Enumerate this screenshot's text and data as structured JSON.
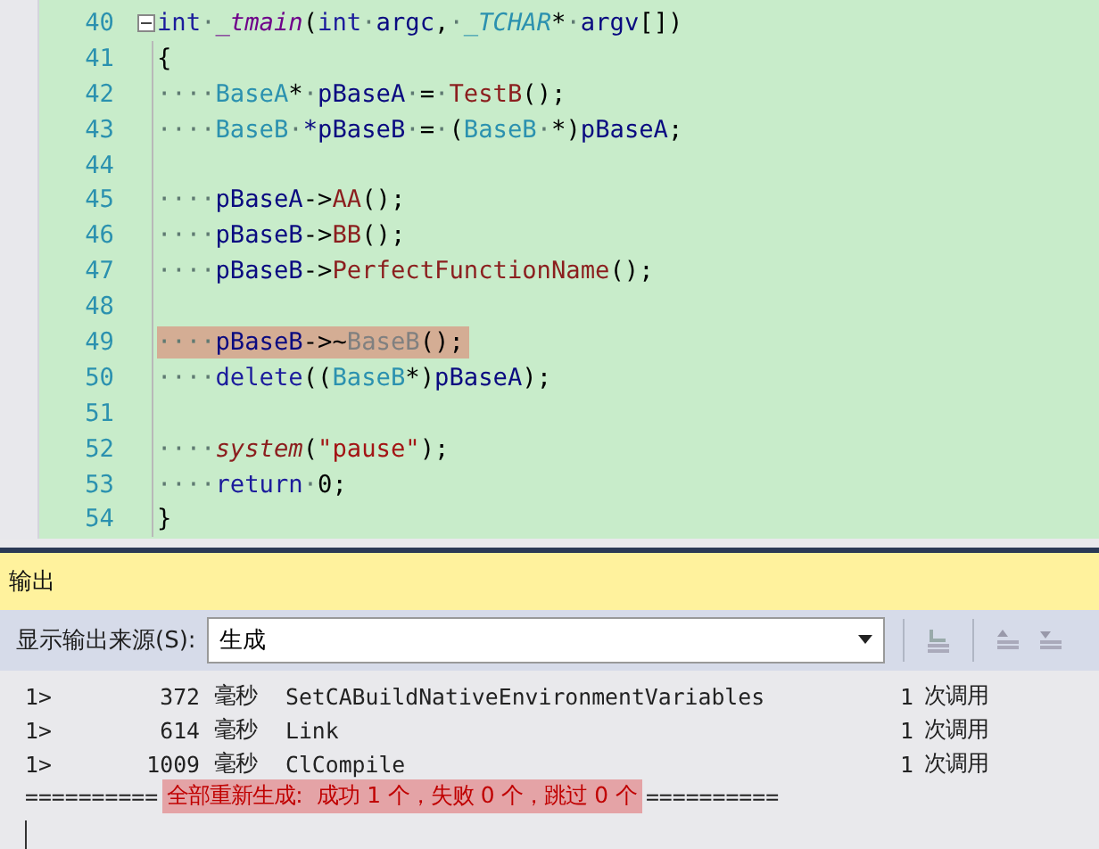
{
  "editor": {
    "lines": [
      {
        "number": "40",
        "highlighted": false,
        "tokens": [
          {
            "kind": "kw",
            "text": "int"
          },
          {
            "kind": "ws",
            "text": "·"
          },
          {
            "kind": "macro",
            "text": "_tmain"
          },
          {
            "kind": "punct",
            "text": "("
          },
          {
            "kind": "kw",
            "text": "int"
          },
          {
            "kind": "ws",
            "text": "·"
          },
          {
            "kind": "ident",
            "text": "argc"
          },
          {
            "kind": "punct",
            "text": ","
          },
          {
            "kind": "ws",
            "text": "·"
          },
          {
            "kind": "typeitalic",
            "text": "_TCHAR"
          },
          {
            "kind": "punct",
            "text": "*"
          },
          {
            "kind": "ws",
            "text": "·"
          },
          {
            "kind": "ident",
            "text": "argv"
          },
          {
            "kind": "punct",
            "text": "[])"
          }
        ]
      },
      {
        "number": "41",
        "highlighted": false,
        "tokens": [
          {
            "kind": "punct",
            "text": "{"
          }
        ]
      },
      {
        "number": "42",
        "highlighted": false,
        "tokens": [
          {
            "kind": "ws",
            "text": "····"
          },
          {
            "kind": "type",
            "text": "BaseA"
          },
          {
            "kind": "punct",
            "text": "*"
          },
          {
            "kind": "ws",
            "text": "·"
          },
          {
            "kind": "ident",
            "text": "pBaseA"
          },
          {
            "kind": "ws",
            "text": "·"
          },
          {
            "kind": "punct",
            "text": "="
          },
          {
            "kind": "ws",
            "text": "·"
          },
          {
            "kind": "func",
            "text": "TestB"
          },
          {
            "kind": "punct",
            "text": "();"
          }
        ]
      },
      {
        "number": "43",
        "highlighted": false,
        "tokens": [
          {
            "kind": "ws",
            "text": "····"
          },
          {
            "kind": "type",
            "text": "BaseB"
          },
          {
            "kind": "ws",
            "text": "·"
          },
          {
            "kind": "ident",
            "text": "*pBaseB"
          },
          {
            "kind": "ws",
            "text": "·"
          },
          {
            "kind": "punct",
            "text": "="
          },
          {
            "kind": "ws",
            "text": "·"
          },
          {
            "kind": "punct",
            "text": "("
          },
          {
            "kind": "type",
            "text": "BaseB"
          },
          {
            "kind": "ws",
            "text": "·"
          },
          {
            "kind": "punct",
            "text": "*)"
          },
          {
            "kind": "ident",
            "text": "pBaseA"
          },
          {
            "kind": "punct",
            "text": ";"
          }
        ]
      },
      {
        "number": "44",
        "highlighted": false
      },
      {
        "number": "45",
        "highlighted": false,
        "tokens": [
          {
            "kind": "ws",
            "text": "····"
          },
          {
            "kind": "ident",
            "text": "pBaseA"
          },
          {
            "kind": "punct",
            "text": "->"
          },
          {
            "kind": "func",
            "text": "AA"
          },
          {
            "kind": "punct",
            "text": "();"
          }
        ]
      },
      {
        "number": "46",
        "highlighted": false,
        "tokens": [
          {
            "kind": "ws",
            "text": "····"
          },
          {
            "kind": "ident",
            "text": "pBaseB"
          },
          {
            "kind": "punct",
            "text": "->"
          },
          {
            "kind": "func",
            "text": "BB"
          },
          {
            "kind": "punct",
            "text": "();"
          }
        ]
      },
      {
        "number": "47",
        "highlighted": false,
        "tokens": [
          {
            "kind": "ws",
            "text": "····"
          },
          {
            "kind": "ident",
            "text": "pBaseB"
          },
          {
            "kind": "punct",
            "text": "->"
          },
          {
            "kind": "func",
            "text": "PerfectFunctionName"
          },
          {
            "kind": "punct",
            "text": "();"
          }
        ]
      },
      {
        "number": "48",
        "highlighted": false
      },
      {
        "number": "49",
        "highlighted": true,
        "tokens": [
          {
            "kind": "ws",
            "text": "····"
          },
          {
            "kind": "ident",
            "text": "pBaseB"
          },
          {
            "kind": "punct",
            "text": "->~"
          },
          {
            "kind": "dim",
            "text": "BaseB"
          },
          {
            "kind": "punct",
            "text": "();"
          }
        ]
      },
      {
        "number": "50",
        "highlighted": false,
        "tokens": [
          {
            "kind": "ws",
            "text": "····"
          },
          {
            "kind": "kw",
            "text": "delete"
          },
          {
            "kind": "punct",
            "text": "(("
          },
          {
            "kind": "type",
            "text": "BaseB"
          },
          {
            "kind": "punct",
            "text": "*)"
          },
          {
            "kind": "ident",
            "text": "pBaseA"
          },
          {
            "kind": "punct",
            "text": ");"
          }
        ]
      },
      {
        "number": "51",
        "highlighted": false
      },
      {
        "number": "52",
        "highlighted": false,
        "tokens": [
          {
            "kind": "ws",
            "text": "····"
          },
          {
            "kind": "funcitalic",
            "text": "system"
          },
          {
            "kind": "punct",
            "text": "("
          },
          {
            "kind": "string",
            "text": "\"pause\""
          },
          {
            "kind": "punct",
            "text": ");"
          }
        ]
      },
      {
        "number": "53",
        "highlighted": false,
        "tokens": [
          {
            "kind": "ws",
            "text": "····"
          },
          {
            "kind": "kw",
            "text": "return"
          },
          {
            "kind": "ws",
            "text": "·"
          },
          {
            "kind": "punct",
            "text": "0;"
          }
        ]
      },
      {
        "number": "54",
        "highlighted": false,
        "tokens": [
          {
            "kind": "punct",
            "text": "}"
          }
        ]
      }
    ]
  },
  "output": {
    "title": "输出",
    "source_label": "显示输出来源(S):",
    "source_value": "生成",
    "rows": [
      {
        "prefix": "1>",
        "time": "372",
        "unit": "毫秒",
        "target": "SetCABuildNativeEnvironmentVariables",
        "count": "1",
        "calls": "次调用"
      },
      {
        "prefix": "1>",
        "time": "614",
        "unit": "毫秒",
        "target": "Link",
        "count": "1",
        "calls": "次调用"
      },
      {
        "prefix": "1>",
        "time": "1009",
        "unit": "毫秒",
        "target": "ClCompile",
        "count": "1",
        "calls": "次调用"
      }
    ],
    "summary": {
      "rule_left": "==========",
      "status": "全部重新生成:  成功 1 个，失败 0 个，跳过 0 个",
      "rule_right": "=========="
    }
  }
}
